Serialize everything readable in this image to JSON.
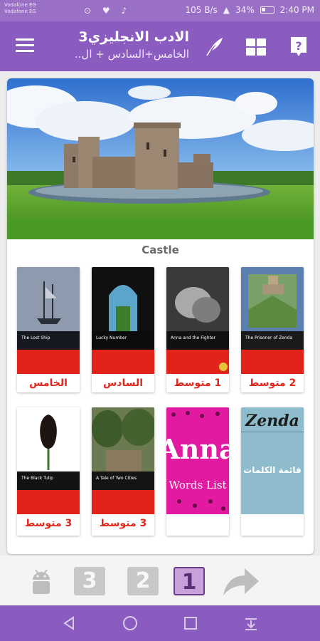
{
  "status_bar": {
    "carrier_line1": "Vodafone EG",
    "carrier_line2": "Vodafone EG",
    "speed": "105 B/s",
    "battery": "34%",
    "time": "2:40 PM"
  },
  "app_bar": {
    "title": "الادب الانجليزي3",
    "subtitle": "الخامس+السادس + ال.."
  },
  "hero": {
    "caption": "Castle"
  },
  "books": [
    {
      "label": "2 متوسط",
      "cover_title": "The Prisoner of Zenda"
    },
    {
      "label": "1 متوسط",
      "cover_title": "Anna and the Fighter"
    },
    {
      "label": "السادس",
      "cover_title": "Lucky Number"
    },
    {
      "label": "الخامس",
      "cover_title": "The Lost Ship"
    },
    {
      "label": "",
      "cover_title": "Zenda",
      "cover_sub": "قائمة الكلمات"
    },
    {
      "label": "",
      "cover_title": "Anna",
      "cover_sub": "Words List"
    },
    {
      "label": "3 متوسط",
      "cover_title": "A Tale of Two Cities"
    },
    {
      "label": "3 متوسط",
      "cover_title": "The Black Tulip"
    }
  ],
  "toolbar": {
    "btn3": "3",
    "btn2": "2",
    "btn1": "1"
  },
  "colors": {
    "primary": "#8a5cc0",
    "label_red": "#e0261d",
    "active_tab": "#c8a0da"
  }
}
